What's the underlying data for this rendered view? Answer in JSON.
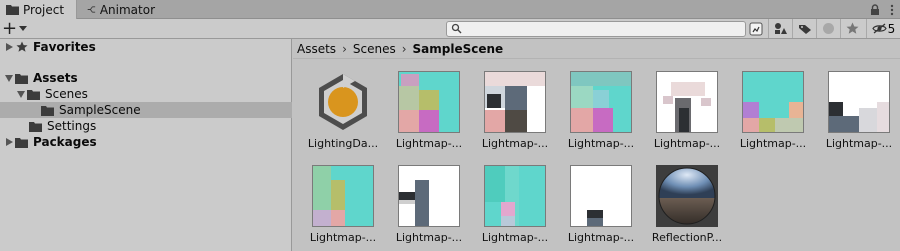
{
  "tabs": [
    {
      "label": "Project",
      "icon": "folder-icon",
      "active": true
    },
    {
      "label": "Animator",
      "icon": "animator-icon",
      "active": false
    }
  ],
  "toolbar": {
    "add_label": "+",
    "search_placeholder": "",
    "hidden_count": "5"
  },
  "tree": [
    {
      "label": "Favorites",
      "bold": true,
      "expanded": false,
      "icon": "star-icon"
    },
    {
      "label": "Assets",
      "bold": true,
      "expanded": true,
      "icon": "folder-open-icon"
    },
    {
      "label": "Scenes",
      "bold": false,
      "expanded": true,
      "icon": "folder-open-icon"
    },
    {
      "label": "SampleScene",
      "bold": false,
      "expanded": false,
      "icon": "folder-icon",
      "selected": true
    },
    {
      "label": "Settings",
      "bold": false,
      "expanded": false,
      "icon": "folder-icon"
    },
    {
      "label": "Packages",
      "bold": true,
      "expanded": false,
      "icon": "folder-icon"
    }
  ],
  "breadcrumb": [
    "Assets",
    "Scenes",
    "SampleScene"
  ],
  "assets": [
    {
      "label": "LightingDa...",
      "kind": "lighting-data"
    },
    {
      "label": "Lightmap-...",
      "kind": "lightmap"
    },
    {
      "label": "Lightmap-...",
      "kind": "lightmap"
    },
    {
      "label": "Lightmap-...",
      "kind": "lightmap"
    },
    {
      "label": "Lightmap-...",
      "kind": "lightmap"
    },
    {
      "label": "Lightmap-...",
      "kind": "lightmap"
    },
    {
      "label": "Lightmap-...",
      "kind": "lightmap"
    },
    {
      "label": "Lightmap-...",
      "kind": "lightmap"
    },
    {
      "label": "Lightmap-...",
      "kind": "lightmap"
    },
    {
      "label": "Lightmap-...",
      "kind": "lightmap"
    },
    {
      "label": "Lightmap-...",
      "kind": "lightmap"
    },
    {
      "label": "ReflectionP...",
      "kind": "reflection-probe"
    }
  ],
  "colors": {
    "lighting_data_orange": "#d9951e",
    "lighting_data_hex": "#4d4d4d",
    "cyan": "#5fd6cc",
    "pink": "#e3a7a6",
    "olive": "#b6be6a",
    "magenta": "#c76bc2",
    "slate": "#5d6a79"
  }
}
